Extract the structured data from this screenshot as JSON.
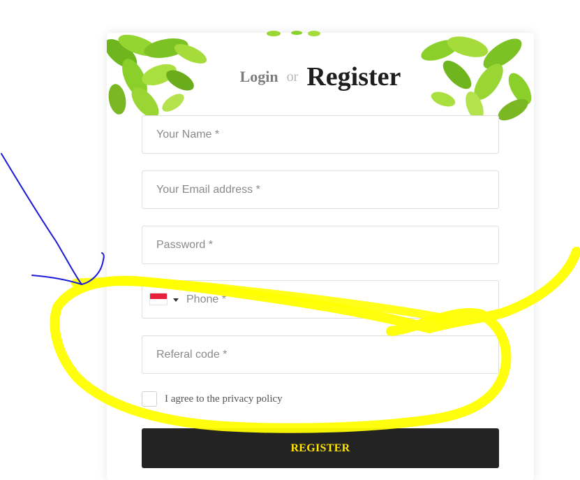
{
  "header": {
    "login_label": "Login",
    "or_label": "or",
    "register_label": "Register"
  },
  "form": {
    "name_placeholder": "Your Name *",
    "email_placeholder": "Your Email address *",
    "password_placeholder": "Password *",
    "phone_placeholder": "Phone *",
    "phone_country_flag": "sg-flag-icon",
    "referral_placeholder": "Referal code *",
    "privacy_label": "I agree to the privacy policy",
    "submit_label": "REGISTER"
  },
  "colors": {
    "leaf_green": "#8fd12a",
    "button_bg": "#232323",
    "button_text": "#ffe600",
    "annotation_yellow": "#ffff00",
    "annotation_blue": "#0000cc"
  }
}
